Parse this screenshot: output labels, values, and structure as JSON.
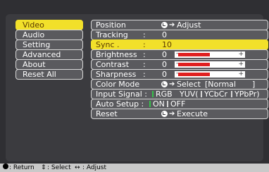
{
  "sidebar": {
    "items": [
      {
        "label": "Video",
        "active": true
      },
      {
        "label": "Audio",
        "active": false
      },
      {
        "label": "Setting",
        "active": false
      },
      {
        "label": "Advanced",
        "active": false
      },
      {
        "label": "About",
        "active": false
      },
      {
        "label": "Reset All",
        "active": false
      }
    ]
  },
  "video": {
    "position": {
      "label": "Position",
      "action": "Adjust"
    },
    "tracking": {
      "label": "Tracking",
      "colon": ":",
      "value": "0"
    },
    "sync": {
      "label": "Sync .",
      "colon": ":",
      "value": "10"
    },
    "brightness": {
      "label": "Brightness",
      "colon": ":",
      "value": "0",
      "level": 0.5
    },
    "contrast": {
      "label": "Contrast",
      "colon": ":",
      "value": "0",
      "level": 0.5
    },
    "sharpness": {
      "label": "Sharpness",
      "colon": ":",
      "value": "0",
      "level": 0.5
    },
    "color_mode": {
      "label": "Color Mode",
      "action": "Select",
      "value": "[Normal",
      "end": "]"
    },
    "input_signal": {
      "label": "Input Signal :",
      "options": [
        "RGB",
        "YUV(",
        "YCbCr",
        "YPbPr)"
      ]
    },
    "auto_setup": {
      "label": "Auto Setup :",
      "on": "ON",
      "off": "OFF"
    },
    "reset": {
      "label": "Reset",
      "action": "Execute"
    }
  },
  "footer": {
    "return": ": Return",
    "select": ": Select",
    "adjust": ": Adjust"
  },
  "colors": {
    "highlight": "#f2e02a",
    "bar_fill": "#e02020",
    "on_mark": "#36c14a"
  }
}
